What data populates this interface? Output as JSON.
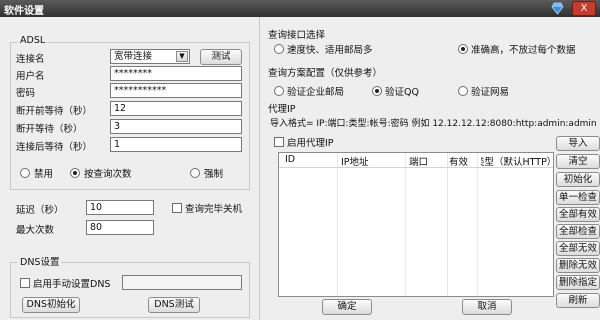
{
  "window": {
    "title": "软件设置",
    "close_glyph": "X"
  },
  "adsl": {
    "legend": "ADSL",
    "connection_label": "连接名",
    "connection_value": "宽带连接",
    "test_button": "测试",
    "username_label": "用户名",
    "username_value": "********",
    "password_label": "密码",
    "password_value": "***********",
    "pre_disconnect_label": "断开前等待（秒）",
    "pre_disconnect_value": "12",
    "disconnect_wait_label": "断开等待（秒）",
    "disconnect_wait_value": "3",
    "post_connect_label": "连接后等待（秒）",
    "post_connect_value": "1",
    "mode_options": [
      "禁用",
      "按查询次数",
      "强制"
    ],
    "mode_selected": 1
  },
  "delay": {
    "delay_label": "延迟（秒）",
    "delay_value": "10",
    "shutdown_label": "查询完毕关机",
    "max_count_label": "最大次数",
    "max_count_value": "80"
  },
  "dns": {
    "legend": "DNS设置",
    "manual_label": "启用手动设置DNS",
    "manual_value": "",
    "init_button": "DNS初始化",
    "test_button": "DNS测试"
  },
  "query_interface": {
    "title": "查询接口选择",
    "options": [
      "速度快、适用邮局多",
      "准确高，不放过每个数据"
    ],
    "selected": 1
  },
  "query_plan": {
    "title": "查询方案配置（仅供参考）",
    "options": [
      "验证企业邮局",
      "验证QQ",
      "验证网易"
    ],
    "selected": 1
  },
  "proxy": {
    "title": "代理IP",
    "format_text": "导入格式= IP:端口:类型:帐号:密码 例如 12.12.12.12:8080:http:admin:admin",
    "enable_label": "启用代理IP",
    "columns": [
      "ID",
      "IP地址",
      "端口",
      "有效",
      "类型（默认HTTP）"
    ]
  },
  "side_buttons": [
    "导入",
    "清空",
    "初始化",
    "单一检查",
    "全部有效",
    "全部检查",
    "全部无效",
    "删除无效",
    "删除指定",
    "刷新"
  ],
  "footer": {
    "ok_button": "确定",
    "cancel_button": "取消"
  },
  "colors": {
    "titlebar": "#3d3d3d",
    "close": "#c63b2b",
    "accent_gem": "#3a8fd8"
  }
}
